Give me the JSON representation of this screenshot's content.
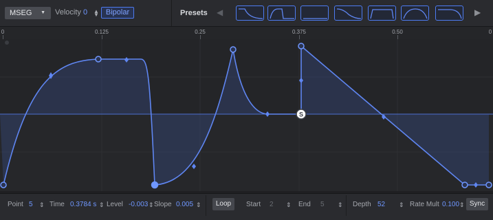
{
  "toolbar": {
    "mode": "MSEG",
    "velocity_label": "Velocity",
    "velocity_value": "0",
    "bipolar_label": "Bipolar",
    "presets_label": "Presets"
  },
  "presets": [
    "ramp-down",
    "rise-hold",
    "square",
    "decay",
    "pulse",
    "arc",
    "fall-curve"
  ],
  "ruler": {
    "ticks": [
      "0",
      "0.125",
      "0.25",
      "0.375",
      "0.50",
      "0"
    ]
  },
  "envelope": {
    "point_count": 5,
    "sustain_marker": "S"
  },
  "bottom": {
    "point_label": "Point",
    "point_value": "5",
    "time_label": "Time",
    "time_value": "0.3784 s",
    "level_label": "Level",
    "level_value": "-0.003",
    "slope_label": "Slope",
    "slope_value": "0.005",
    "loop_label": "Loop",
    "start_label": "Start",
    "start_value": "2",
    "end_label": "End",
    "end_value": "5",
    "depth_label": "Depth",
    "depth_value": "52",
    "rate_label": "Rate Mult",
    "rate_value": "0.100",
    "sync_label": "Sync"
  },
  "colors": {
    "accent": "#4d7cf3",
    "curve": "#5f86f2",
    "value_text": "#6f97ff"
  }
}
